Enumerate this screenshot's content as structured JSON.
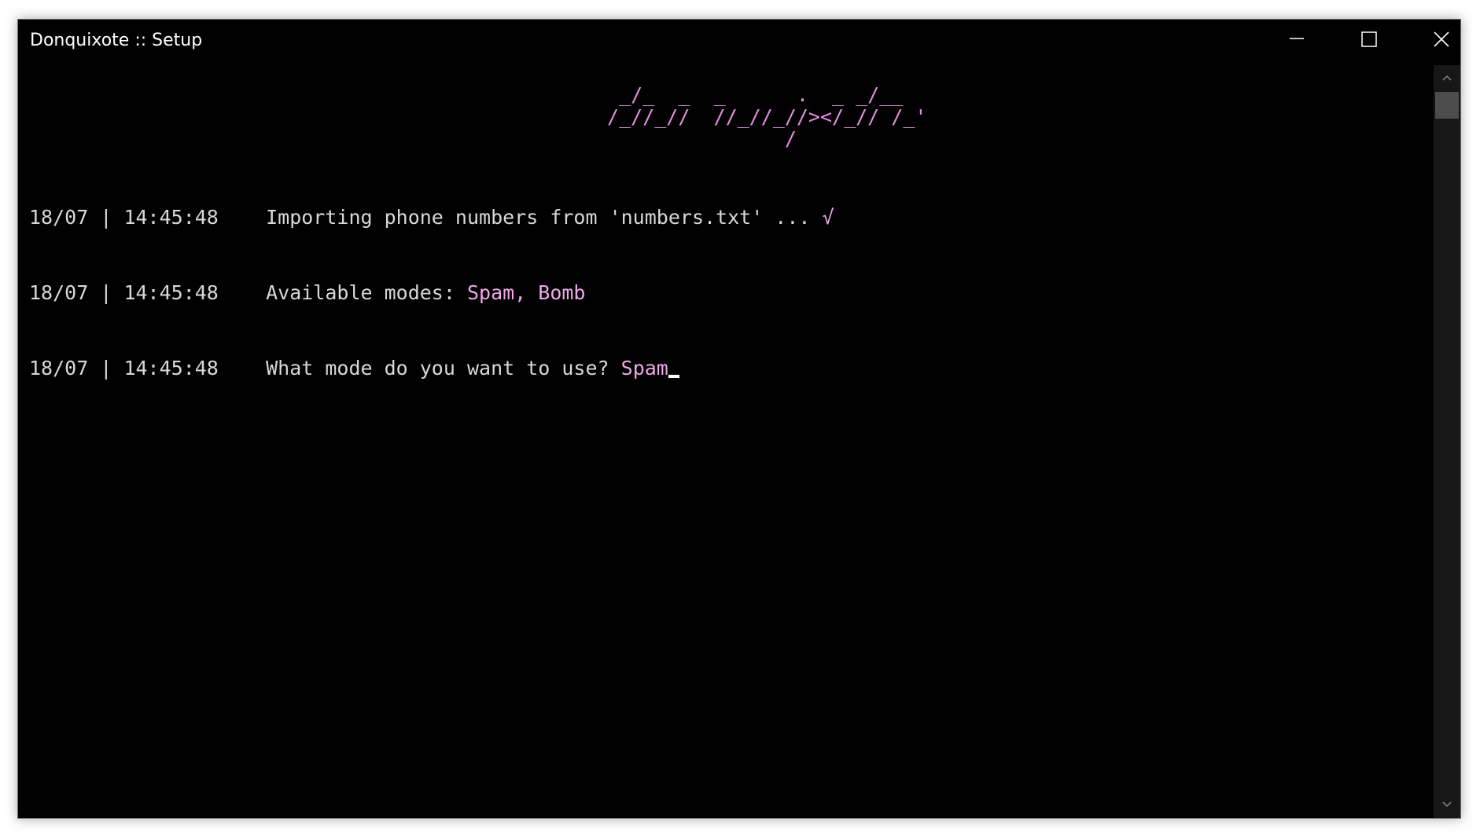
{
  "window": {
    "title": "Donquixote :: Setup"
  },
  "banner": {
    "lines": [
      "  _/_  _  _      .  _ _/__",
      " /_//_//  //_//_//></_// /_'",
      "                /"
    ],
    "color": "#e38ee0"
  },
  "logs": [
    {
      "date": "18/07",
      "separator": "|",
      "time": "14:45:48",
      "message": "Importing phone numbers from 'numbers.txt' ... ",
      "highlight": "√"
    },
    {
      "date": "18/07",
      "separator": "|",
      "time": "14:45:48",
      "message": "Available modes: ",
      "highlight": "Spam, Bomb"
    },
    {
      "date": "18/07",
      "separator": "|",
      "time": "14:45:48",
      "message": "What mode do you want to use? ",
      "highlight": "Spam"
    }
  ],
  "colors": {
    "background": "#000000",
    "text": "#d8d8d8",
    "accent": "#f0a8e8"
  },
  "icons": {
    "minimize": "minimize-icon",
    "maximize": "maximize-icon",
    "close": "close-icon",
    "scroll_up": "chevron-up-icon",
    "scroll_down": "chevron-down-icon"
  }
}
